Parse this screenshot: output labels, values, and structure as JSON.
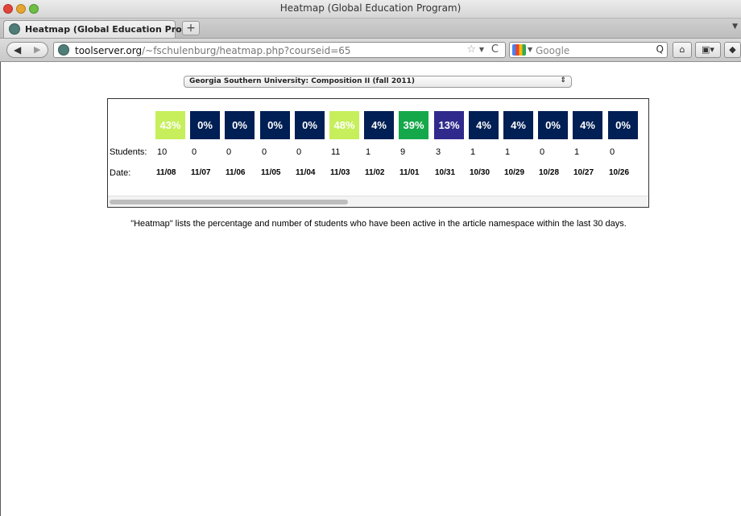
{
  "window": {
    "title": "Heatmap (Global Education Program)"
  },
  "tabs": [
    {
      "label": "Heatmap (Global Education Pro...",
      "close": "×"
    }
  ],
  "new_tab": "+",
  "nav": {
    "back": "◀",
    "forward": "▶",
    "url_host": "toolserver.org",
    "url_path": "/~fschulenburg/heatmap.php?courseid=65",
    "star": "☆",
    "dropdown": "▼",
    "reload": "C",
    "search_placeholder": "Google",
    "search_icon": "Q",
    "home": "⌂",
    "bookmarks": "▣▾",
    "evernote": "◆"
  },
  "page": {
    "course_select": "Georgia Southern University: Composition II (fall 2011)",
    "select_arrows": "⇕",
    "row_labels": {
      "students": "Students:",
      "date": "Date:"
    },
    "explanation": "\"Heatmap\" lists the percentage and number of students who have been active in the article namespace within the last 30 days."
  },
  "heatmap": {
    "columns": [
      {
        "pct": "43%",
        "students": "10",
        "date": "11/08",
        "color": "#c6ef5b"
      },
      {
        "pct": "0%",
        "students": "0",
        "date": "11/07",
        "color": "#001f54"
      },
      {
        "pct": "0%",
        "students": "0",
        "date": "11/06",
        "color": "#001f54"
      },
      {
        "pct": "0%",
        "students": "0",
        "date": "11/05",
        "color": "#001f54"
      },
      {
        "pct": "0%",
        "students": "0",
        "date": "11/04",
        "color": "#001f54"
      },
      {
        "pct": "48%",
        "students": "11",
        "date": "11/03",
        "color": "#c6ef5b"
      },
      {
        "pct": "4%",
        "students": "1",
        "date": "11/02",
        "color": "#001f54"
      },
      {
        "pct": "39%",
        "students": "9",
        "date": "11/01",
        "color": "#15a84a"
      },
      {
        "pct": "13%",
        "students": "3",
        "date": "10/31",
        "color": "#2f2a8c"
      },
      {
        "pct": "4%",
        "students": "1",
        "date": "10/30",
        "color": "#001f54"
      },
      {
        "pct": "4%",
        "students": "1",
        "date": "10/29",
        "color": "#001f54"
      },
      {
        "pct": "0%",
        "students": "0",
        "date": "10/28",
        "color": "#001f54"
      },
      {
        "pct": "4%",
        "students": "1",
        "date": "10/27",
        "color": "#001f54"
      },
      {
        "pct": "0%",
        "students": "0",
        "date": "10/26",
        "color": "#001f54"
      }
    ]
  }
}
